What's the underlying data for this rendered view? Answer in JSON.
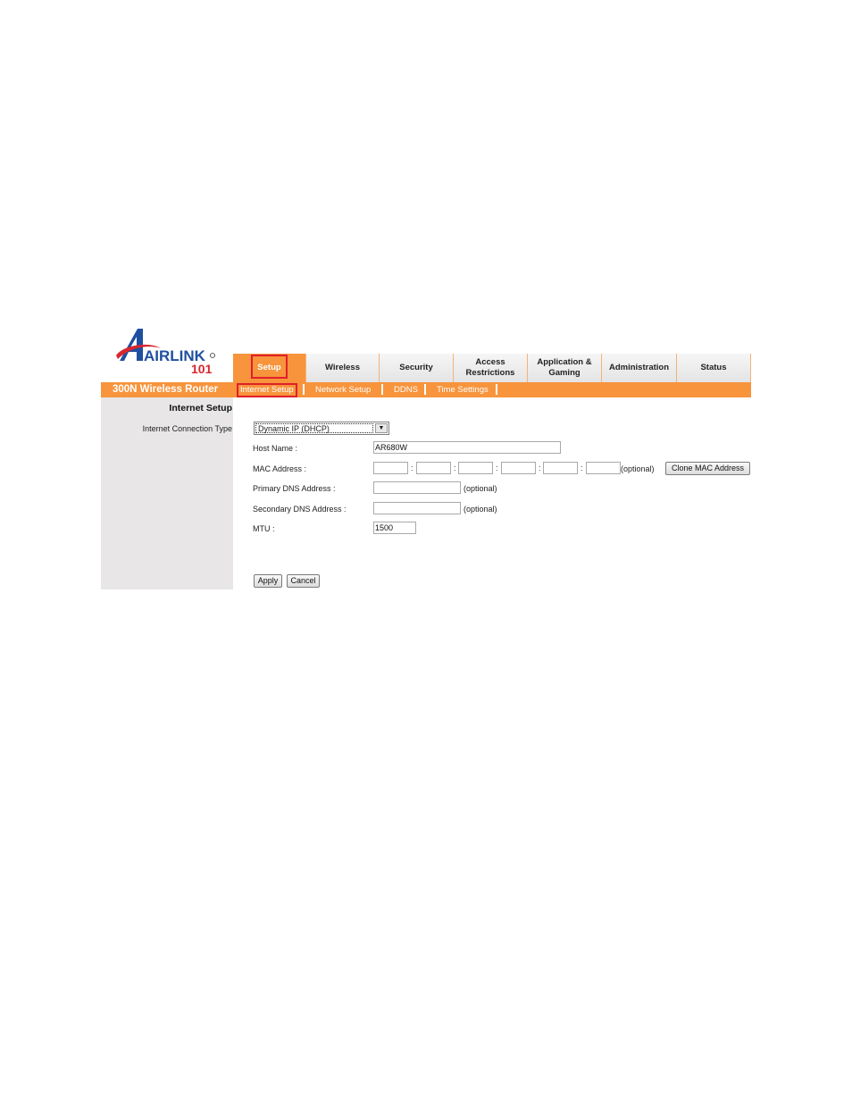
{
  "brand": {
    "logo_text": "AIRLINK",
    "logo_sub": "101",
    "product_name": "300N Wireless Router",
    "colors": {
      "accent": "#f7943c",
      "highlight": "#e0202a",
      "logo_blue": "#1f4fa0",
      "logo_red": "#d8262c"
    }
  },
  "tabs": [
    {
      "label": "Setup",
      "active": true
    },
    {
      "label": "Wireless",
      "active": false
    },
    {
      "label": "Security",
      "active": false
    },
    {
      "label": "Access Restrictions",
      "active": false
    },
    {
      "label": "Application & Gaming",
      "active": false
    },
    {
      "label": "Administration",
      "active": false
    },
    {
      "label": "Status",
      "active": false
    }
  ],
  "subtabs": [
    {
      "label": "Internet Setup",
      "active": true
    },
    {
      "label": "Network Setup",
      "active": false
    },
    {
      "label": "DDNS",
      "active": false
    },
    {
      "label": "Time Settings",
      "active": false
    }
  ],
  "section": {
    "title": "Internet Setup",
    "connection_type_label": "Internet Connection Type",
    "connection_type_value": "Dynamic IP (DHCP)"
  },
  "form": {
    "host_name_label": "Host Name :",
    "host_name_value": "AR680W",
    "mac_label": "MAC Address :",
    "mac_values": [
      "",
      "",
      "",
      "",
      "",
      ""
    ],
    "mac_separator": ":",
    "optional_text": "(optional)",
    "clone_mac_label": "Clone MAC Address",
    "primary_dns_label": "Primary DNS Address :",
    "primary_dns_value": "",
    "secondary_dns_label": "Secondary DNS Address :",
    "secondary_dns_value": "",
    "mtu_label": "MTU :",
    "mtu_value": "1500"
  },
  "actions": {
    "apply_label": "Apply",
    "cancel_label": "Cancel"
  }
}
